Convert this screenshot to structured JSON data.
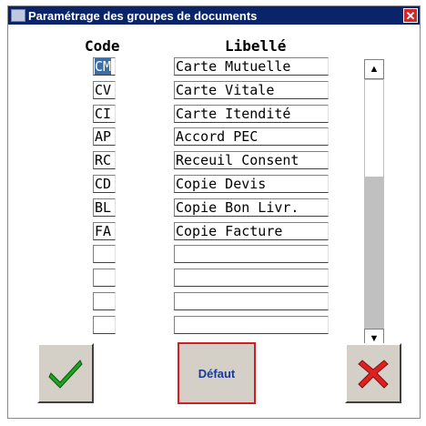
{
  "window": {
    "title": "Paramétrage des groupes de documents",
    "close_label": "✕"
  },
  "headers": {
    "code": "Code",
    "libelle": "Libellé"
  },
  "rows": [
    {
      "code": "CM",
      "libelle": "Carte Mutuelle"
    },
    {
      "code": "CV",
      "libelle": "Carte Vitale"
    },
    {
      "code": "CI",
      "libelle": "Carte Itendité"
    },
    {
      "code": "AP",
      "libelle": "Accord PEC"
    },
    {
      "code": "RC",
      "libelle": "Receuil Consent"
    },
    {
      "code": "CD",
      "libelle": "Copie Devis"
    },
    {
      "code": "BL",
      "libelle": "Copie Bon Livr."
    },
    {
      "code": "FA",
      "libelle": "Copie Facture"
    },
    {
      "code": "",
      "libelle": ""
    },
    {
      "code": "",
      "libelle": ""
    },
    {
      "code": "",
      "libelle": ""
    },
    {
      "code": "",
      "libelle": ""
    }
  ],
  "selected_row": 0,
  "buttons": {
    "ok_icon": "green-checkmark-icon",
    "default_label": "Défaut",
    "cancel_icon": "red-cross-icon"
  },
  "colors": {
    "title_bar": "#0a246a",
    "selection": "#3a6ea5",
    "default_border": "#d02020",
    "check": "#22a022",
    "cross": "#e02020"
  }
}
